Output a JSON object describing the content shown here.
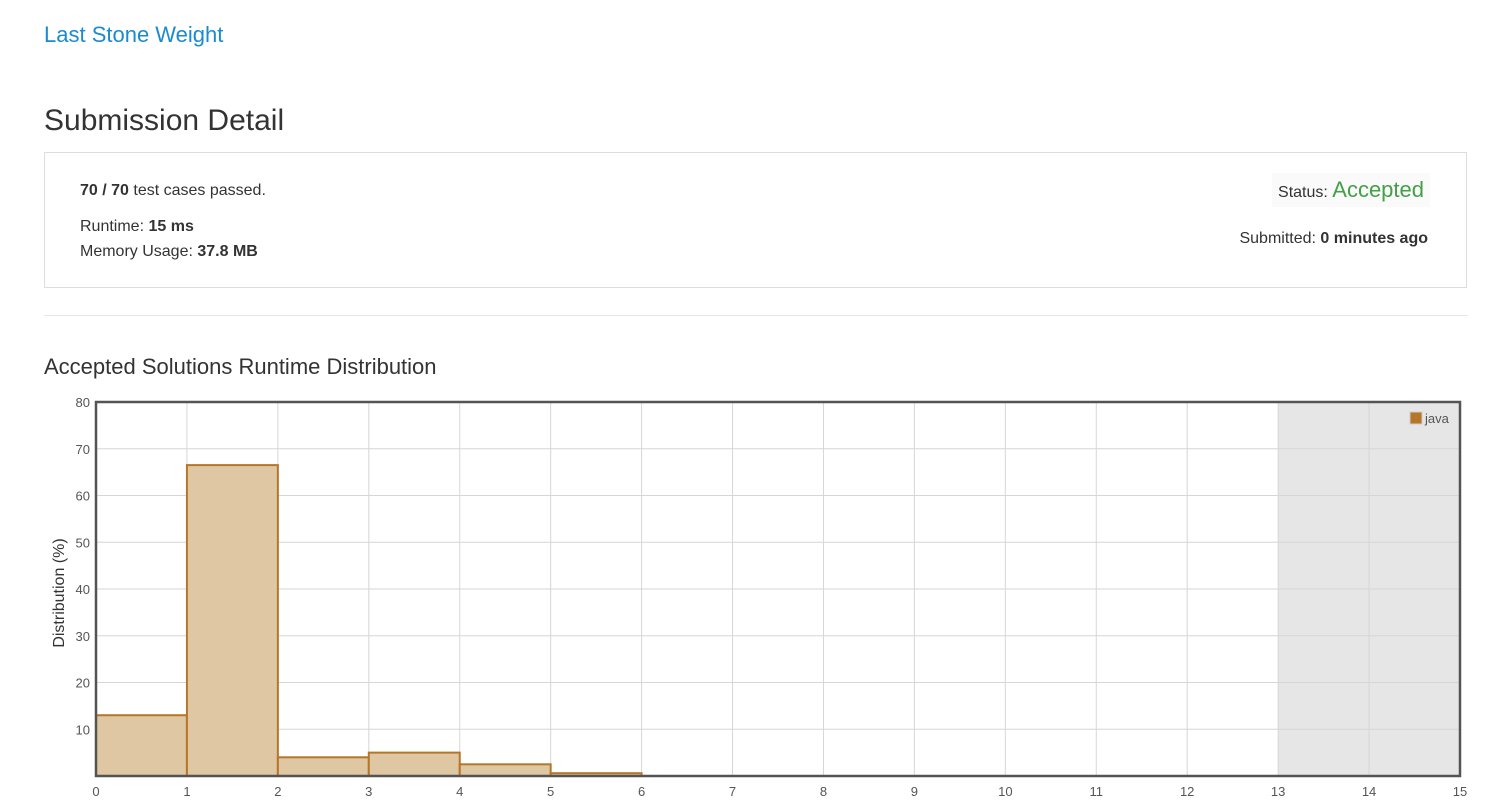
{
  "problem": {
    "title": "Last Stone Weight"
  },
  "page": {
    "heading": "Submission Detail"
  },
  "submission": {
    "passed": "70",
    "separator": " / ",
    "total": "70",
    "cases_suffix": " test cases passed.",
    "runtime_label": "Runtime: ",
    "runtime_value": "15 ms",
    "memory_label": "Memory Usage: ",
    "memory_value": "37.8 MB",
    "status_label": "Status: ",
    "status_value": "Accepted",
    "status_color": "#43a047",
    "submitted_label": "Submitted: ",
    "submitted_value": "0 minutes ago"
  },
  "distribution": {
    "heading": "Accepted Solutions Runtime Distribution"
  },
  "chart_data": {
    "type": "bar",
    "title": "",
    "xlabel": "",
    "ylabel": "Distribution (%)",
    "xlim": [
      0,
      15
    ],
    "ylim": [
      0,
      80
    ],
    "x_ticks": [
      0,
      1,
      2,
      3,
      4,
      5,
      6,
      7,
      8,
      9,
      10,
      11,
      12,
      13,
      14,
      15
    ],
    "y_ticks": [
      10,
      20,
      30,
      40,
      50,
      60,
      70,
      80
    ],
    "grid": true,
    "legend_placement": "top-right",
    "highlight_range": [
      13,
      15
    ],
    "series": [
      {
        "name": "java",
        "color": "#b5762a",
        "fill": "#dfc7a3",
        "bins": [
          {
            "x0": 0,
            "x1": 1,
            "value": 13
          },
          {
            "x0": 1,
            "x1": 2,
            "value": 66.5
          },
          {
            "x0": 2,
            "x1": 3,
            "value": 4
          },
          {
            "x0": 3,
            "x1": 4,
            "value": 5
          },
          {
            "x0": 4,
            "x1": 5,
            "value": 2.5
          },
          {
            "x0": 5,
            "x1": 6,
            "value": 0.6
          }
        ]
      }
    ]
  }
}
